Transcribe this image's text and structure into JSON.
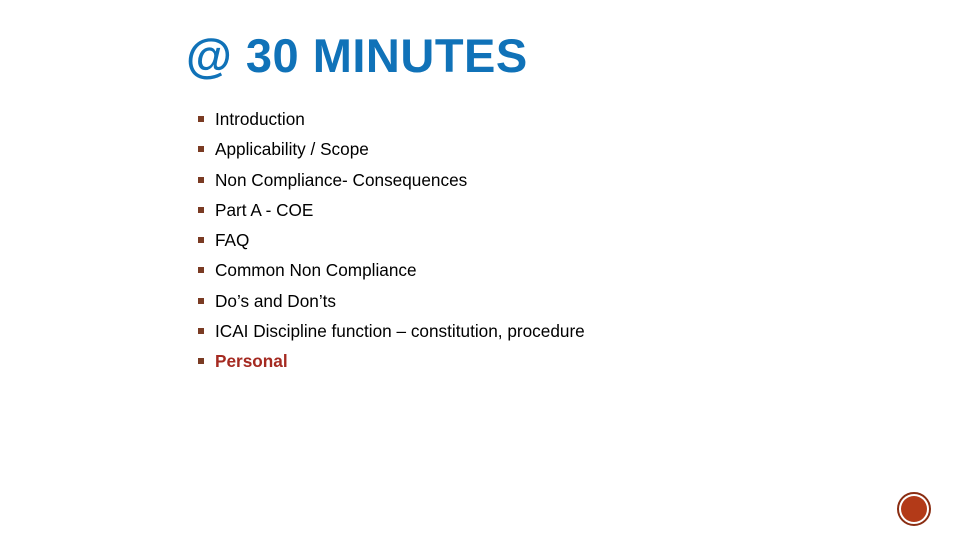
{
  "slide": {
    "background_color": "#FFFFFF",
    "title": "@ 30 MINUTES",
    "title_color": "#1072B8",
    "agenda": {
      "bullet_color": "#7A3B23",
      "text_color": "#000000",
      "highlight_color": "#A52A21",
      "items": [
        {
          "label": "Introduction",
          "highlight": false
        },
        {
          "label": "Applicability / Scope",
          "highlight": false
        },
        {
          "label": "Non Compliance- Consequences",
          "highlight": false
        },
        {
          "label": "Part A - COE",
          "highlight": false
        },
        {
          "label": "FAQ",
          "highlight": false
        },
        {
          "label": "Common Non Compliance",
          "highlight": false
        },
        {
          "label": "Do’s and Don’ts",
          "highlight": false
        },
        {
          "label": "ICAI Discipline function – constitution, procedure",
          "highlight": false
        },
        {
          "label": "Personal",
          "highlight": true
        }
      ]
    },
    "decoration": {
      "name": "corner-circle",
      "ring_color": "#8A2D12",
      "fill_color": "#B33A18"
    }
  }
}
